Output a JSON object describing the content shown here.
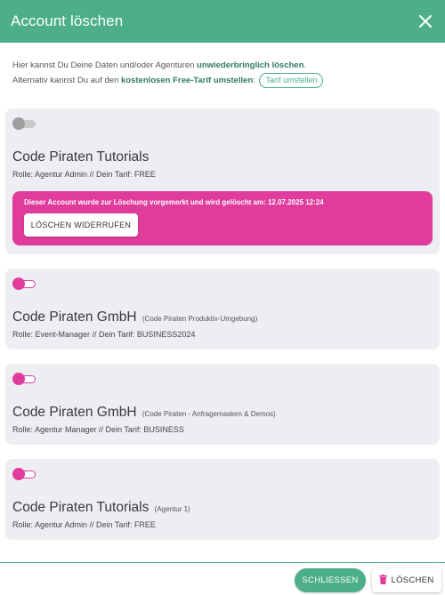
{
  "dialog": {
    "title": "Account löschen"
  },
  "intro": {
    "line1_a": "Hier kannst Du Deine Daten und/oder Agenturen ",
    "line1_b": "unwiederbringlich löschen",
    "line1_c": ".",
    "line2_a": "Alternativ kannst Du auf den ",
    "line2_b": "kostenlosen Free-Tarif umstellen",
    "line2_c": ":",
    "tarif_button": "Tarif umstellen"
  },
  "accounts": [
    {
      "name": "Code Piraten Tutorials",
      "sub": "",
      "role": "Rolle: Agentur Admin // Dein Tarif: FREE",
      "toggle": "off",
      "alert": {
        "text": "Dieser Account wurde zur Löschung vorgemerkt und wird gelöscht am: 12.07.2025 12:24",
        "button": "LÖSCHEN WIDERRUFEN"
      }
    },
    {
      "name": "Code Piraten GmbH",
      "sub": "(Code Piraten Produktiv-Umgebung)",
      "role": "Rolle: Event-Manager // Dein Tarif: BUSINESS2024",
      "toggle": "on"
    },
    {
      "name": "Code Piraten GmbH",
      "sub": "(Code Piraten - Anfragemasken & Demos)",
      "role": "Rolle: Agentur Manager // Dein Tarif: BUSINESS",
      "toggle": "on"
    },
    {
      "name": "Code Piraten Tutorials",
      "sub": "(Agentur 1)",
      "role": "Rolle: Agentur Admin // Dein Tarif: FREE",
      "toggle": "on"
    }
  ],
  "footer": {
    "close_label": "SCHLIESSEN",
    "delete_label": "LÖSCHEN"
  },
  "colors": {
    "primary": "#4caf88",
    "accent": "#e03c9c",
    "card_bg": "#eceef2"
  },
  "icons": {
    "close": "close-icon",
    "trash": "trash-icon"
  }
}
